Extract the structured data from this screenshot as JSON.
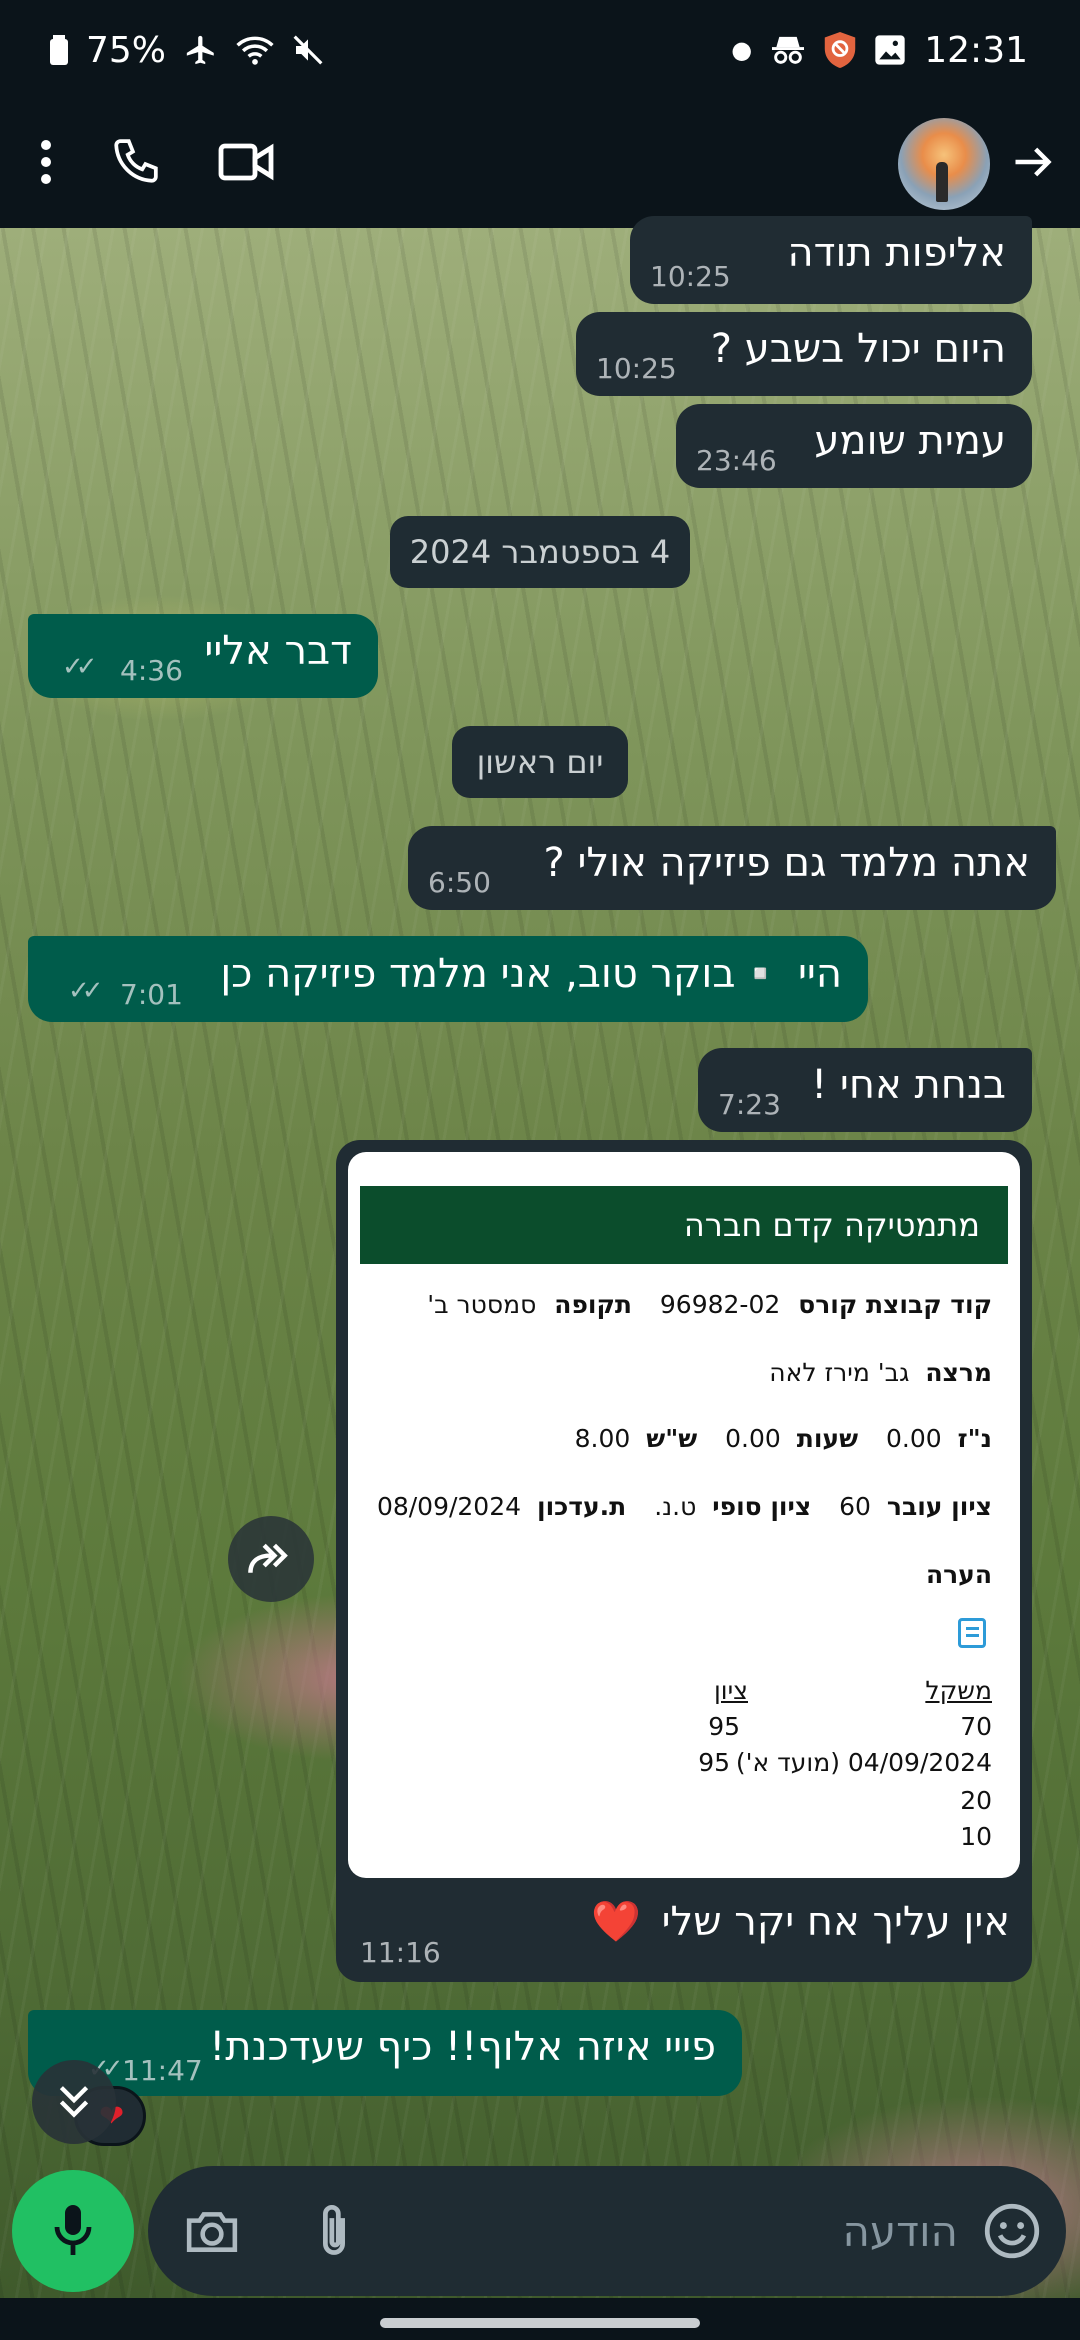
{
  "status_bar": {
    "battery": "75%",
    "time": "12:31"
  },
  "header": {
    "contact_name": "",
    "icons": [
      "more-vert-icon",
      "phone-icon",
      "video-icon",
      "back-arrow-icon"
    ]
  },
  "messages": [
    {
      "dir": "in",
      "text": "אליפות תודה",
      "time": "10:25"
    },
    {
      "dir": "in",
      "text": "היום יכול בשבע ?",
      "time": "10:25"
    },
    {
      "dir": "in",
      "text": "עמית שומע",
      "time": "23:46"
    },
    {
      "dir": "date",
      "text": "4 בספטמבר 2024"
    },
    {
      "dir": "out",
      "text": "דבר אליי",
      "time": "4:36",
      "ticks": "✓✓"
    },
    {
      "dir": "date",
      "text": "יום ראשון"
    },
    {
      "dir": "in",
      "text": "אתה מלמד גם פיזיקה אולי ?",
      "time": "6:50"
    },
    {
      "dir": "out",
      "text": "היי ▫️בוקר טוב, אני מלמד פיזיקה כן",
      "time": "7:01",
      "ticks": "✓✓"
    },
    {
      "dir": "in",
      "text": "בנחת אחי !",
      "time": "7:23"
    }
  ],
  "card": {
    "title": "מתמטיקה קדם חברה",
    "group_code_label": "קוד קבוצת קורס",
    "group_code": "96982-02",
    "period_label": "תקופה",
    "period": "סמסטר ב'",
    "lecturer_label": "מרצה",
    "lecturer": "גב' מירז לאה",
    "nz_label": "נ\"ז",
    "nz": "0.00",
    "hours_label": "שעות",
    "hours": "0.00",
    "ss_label": "ש\"ש",
    "ss": "8.00",
    "pass_label": "ציון עובר",
    "pass": "60",
    "final_label": "ציון סופי",
    "final": "ט.נ.",
    "updated_label": "ת.עדכון",
    "updated": "08/09/2024",
    "note_label": "הערה",
    "weight_header": "משקל",
    "grade_header": "ציון",
    "rows": [
      {
        "weight": "70",
        "grade": "95"
      },
      {
        "weight": "04/09/2024 (מועד א')",
        "grade": "95"
      },
      {
        "weight": "20",
        "grade": ""
      },
      {
        "weight": "10",
        "grade": ""
      }
    ],
    "caption": "אין עליך אח יקר שלי",
    "caption_emoji": "❤️",
    "time": "11:16"
  },
  "last_message": {
    "text": "פייי איזה אלוף!! כיף שעדכנת!",
    "time": "11:47",
    "ticks": "✓✓"
  },
  "composer": {
    "placeholder": "הודעה"
  }
}
